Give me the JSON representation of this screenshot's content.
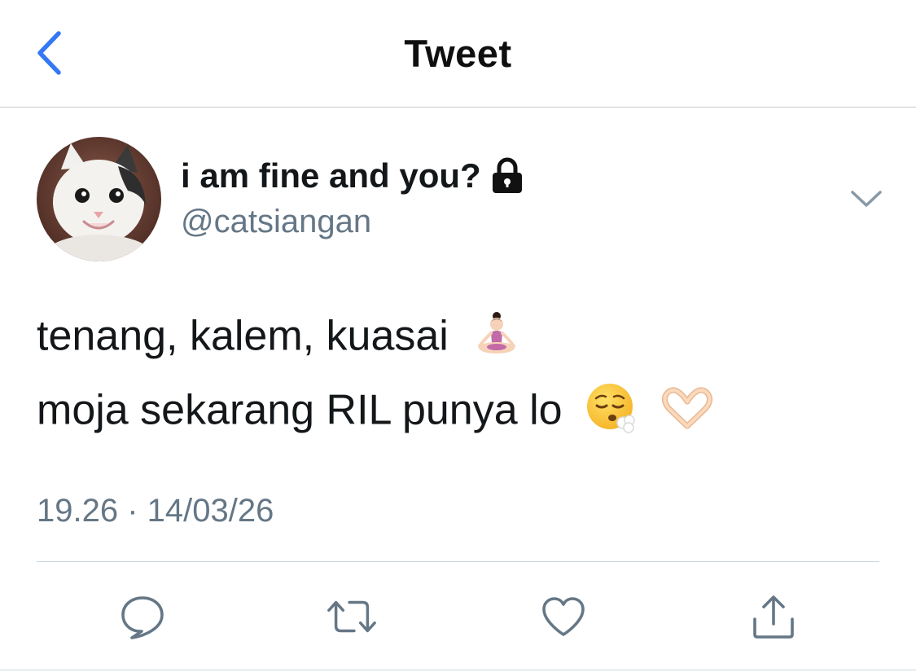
{
  "header": {
    "title": "Tweet",
    "back_icon": "chevron-left-icon",
    "accent_color": "#3478f6"
  },
  "author": {
    "display_name": "i am fine and you?",
    "handle": "@catsiangan",
    "protected_icon": "lock-icon",
    "avatar": "cat-avatar"
  },
  "tweet": {
    "line1": "tenang, kalem, kuasai",
    "line1_emoji": "person-in-lotus-position-emoji",
    "line2": "moja sekarang RIL punya lo",
    "line2_emojis": [
      "face-exhaling-emoji",
      "heart-hands-emoji"
    ],
    "timestamp": "19.26 · 14/03/26"
  },
  "actions": [
    {
      "name": "reply",
      "icon": "reply-icon"
    },
    {
      "name": "retweet",
      "icon": "retweet-icon"
    },
    {
      "name": "like",
      "icon": "heart-icon"
    },
    {
      "name": "share",
      "icon": "share-icon"
    }
  ],
  "colors": {
    "text_primary": "#14171a",
    "text_secondary": "#657786",
    "icon_gray": "#657786",
    "divider": "#ccd6dd"
  }
}
